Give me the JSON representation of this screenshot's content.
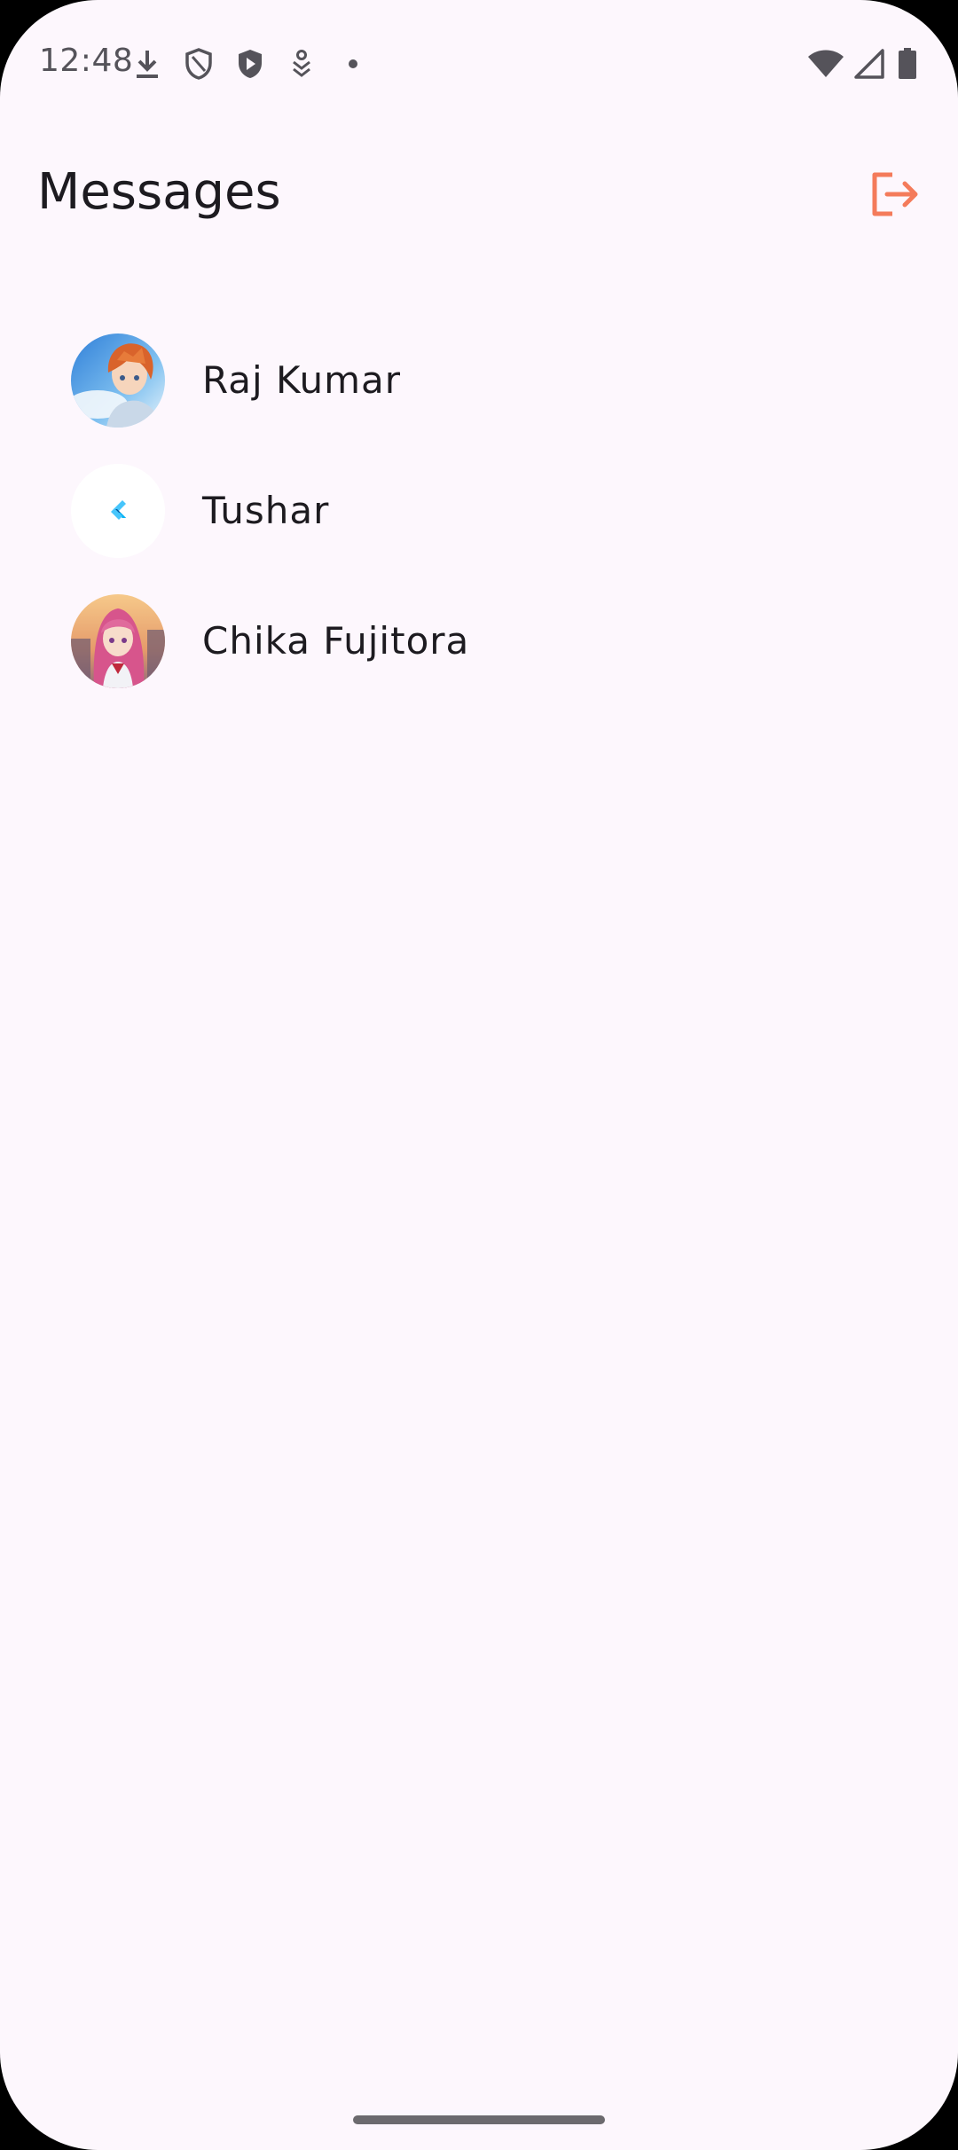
{
  "status_bar": {
    "time": "12:48",
    "left_icons": [
      "download-icon",
      "shield-outline-icon",
      "play-shield-icon",
      "location-badge-icon",
      "dot-icon"
    ],
    "right_icons": [
      "wifi-icon",
      "cellular-signal-icon",
      "battery-icon"
    ]
  },
  "app_bar": {
    "title": "Messages",
    "logout_icon": "logout-icon",
    "accent_color": "#F47B5B"
  },
  "conversations": [
    {
      "name": "Raj Kumar",
      "avatar": "avatar-anime-boy"
    },
    {
      "name": "Tushar",
      "avatar": "avatar-flutter-logo"
    },
    {
      "name": "Chika Fujitora",
      "avatar": "avatar-anime-girl"
    }
  ],
  "colors": {
    "background": "#FDF7FD",
    "text_primary": "#1D1B20",
    "status_text": "#55535A"
  }
}
